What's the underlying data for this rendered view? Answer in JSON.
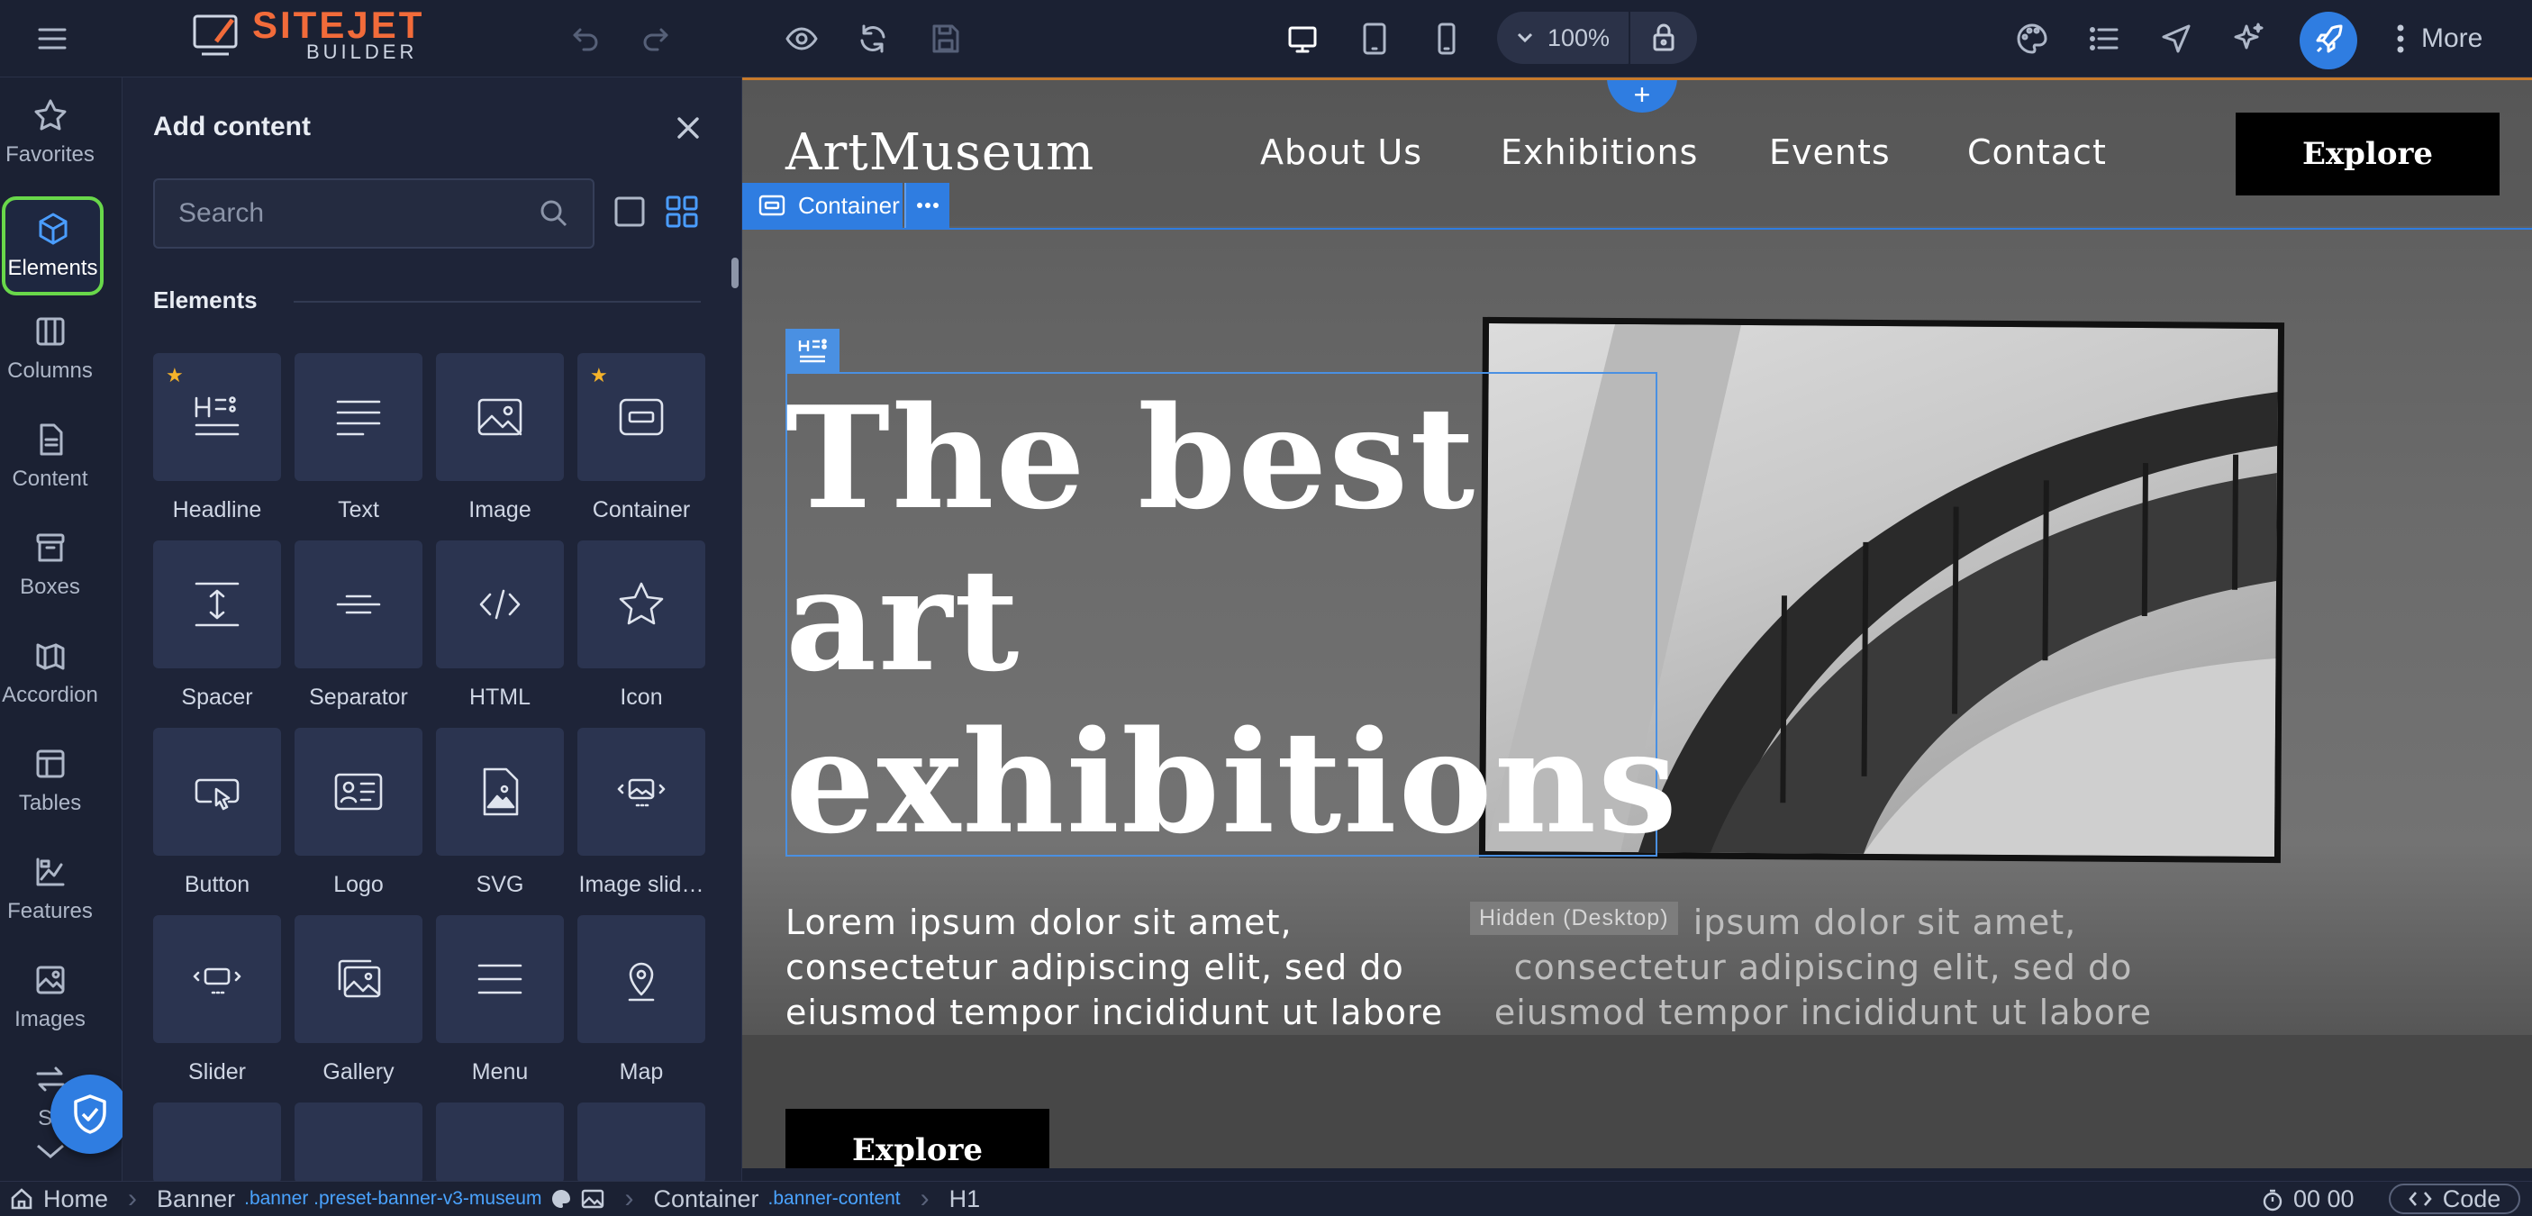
{
  "app": {
    "logo_text": "SITEJET",
    "logo_sub": "BUILDER"
  },
  "toolbar": {
    "zoom": "100%",
    "more_label": "More"
  },
  "rail": {
    "items": [
      {
        "label": "Favorites",
        "icon": "star-icon"
      },
      {
        "label": "Elements",
        "icon": "cube-icon"
      },
      {
        "label": "Columns",
        "icon": "columns-icon"
      },
      {
        "label": "Content",
        "icon": "document-icon"
      },
      {
        "label": "Boxes",
        "icon": "box-icon"
      },
      {
        "label": "Accordion",
        "icon": "accordion-icon"
      },
      {
        "label": "Tables",
        "icon": "table-icon"
      },
      {
        "label": "Features",
        "icon": "features-icon"
      },
      {
        "label": "Images",
        "icon": "image-icon"
      },
      {
        "label": "Sli",
        "icon": "swap-icon"
      }
    ]
  },
  "panel": {
    "title": "Add content",
    "search_placeholder": "Search",
    "section_label": "Elements",
    "tiles": [
      {
        "label": "Headline",
        "icon": "headline-icon",
        "favorite": true
      },
      {
        "label": "Text",
        "icon": "text-icon",
        "favorite": false
      },
      {
        "label": "Image",
        "icon": "image-icon",
        "favorite": false
      },
      {
        "label": "Container",
        "icon": "container-icon",
        "favorite": true
      },
      {
        "label": "Spacer",
        "icon": "spacer-icon",
        "favorite": false
      },
      {
        "label": "Separator",
        "icon": "separator-icon",
        "favorite": false
      },
      {
        "label": "HTML",
        "icon": "code-icon",
        "favorite": false
      },
      {
        "label": "Icon",
        "icon": "star-icon",
        "favorite": false
      },
      {
        "label": "Button",
        "icon": "button-icon",
        "favorite": false
      },
      {
        "label": "Logo",
        "icon": "logo-icon",
        "favorite": false
      },
      {
        "label": "SVG",
        "icon": "svg-icon",
        "favorite": false
      },
      {
        "label": "Image slid…",
        "icon": "image-slider-icon",
        "favorite": false
      },
      {
        "label": "Slider",
        "icon": "slider-icon",
        "favorite": false
      },
      {
        "label": "Gallery",
        "icon": "gallery-icon",
        "favorite": false
      },
      {
        "label": "Menu",
        "icon": "menu-icon",
        "favorite": false
      },
      {
        "label": "Map",
        "icon": "map-pin-icon",
        "favorite": false
      }
    ]
  },
  "site": {
    "brand": "ArtMuseum",
    "nav": [
      "About Us",
      "Exhibitions",
      "Events",
      "Contact"
    ],
    "nav_button": "Explore",
    "headline": "The best art exhibitions",
    "paragraph": "Lorem ipsum dolor sit amet, consectetur adipiscing elit, sed do eiusmod tempor incididunt ut labore",
    "paragraph_hidden": "Lorem ipsum dolor sit amet, consectetur adipiscing elit, sed do eiusmod tempor incididunt ut labore",
    "hidden_badge": "Hidden (Desktop)",
    "cta": "Explore",
    "add_button": "+"
  },
  "selection": {
    "label": "Container"
  },
  "status": {
    "home": "Home",
    "banner": "Banner",
    "banner_class": ".banner .preset-banner-v3-museum",
    "container": "Container",
    "container_class": ".banner-content",
    "element": "H1",
    "timer": "00 00",
    "code_label": "Code"
  }
}
